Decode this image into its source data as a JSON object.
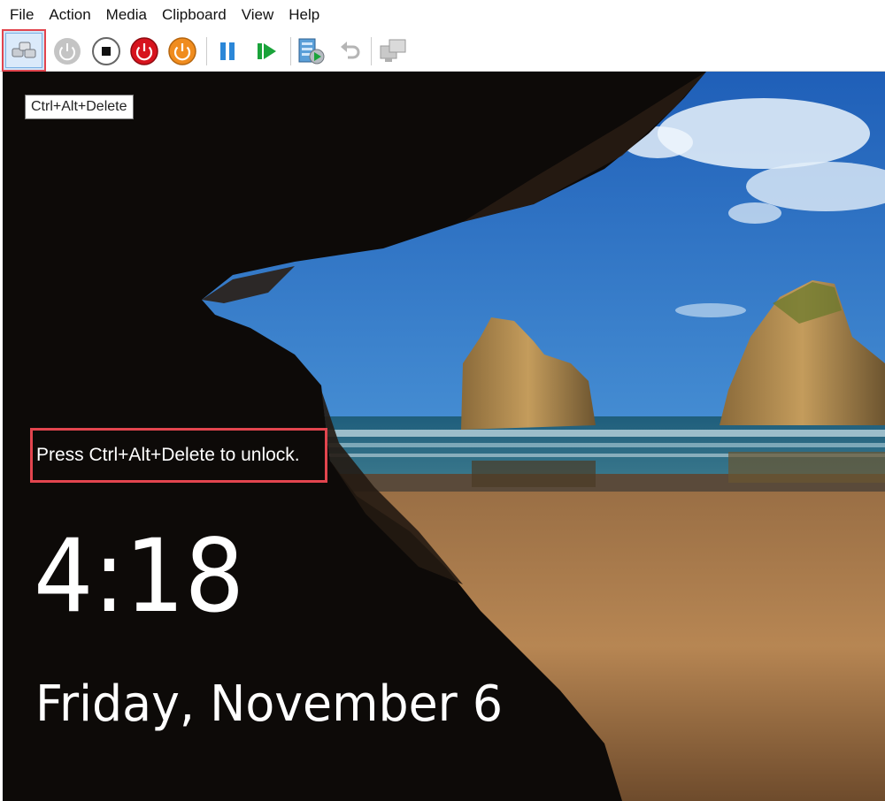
{
  "menu": [
    "File",
    "Action",
    "Media",
    "Clipboard",
    "View",
    "Help"
  ],
  "toolbar": {
    "buttons": [
      {
        "name": "ctrl-alt-delete",
        "icon": "ctrl-alt-delete-icon",
        "selected": true
      },
      {
        "name": "start",
        "icon": "start-icon"
      },
      {
        "name": "turn-off",
        "icon": "turn-off-icon"
      },
      {
        "name": "shut-down",
        "icon": "shut-down-icon"
      },
      {
        "name": "save",
        "icon": "save-icon"
      },
      {
        "name": "pause",
        "icon": "pause-icon"
      },
      {
        "name": "reset",
        "icon": "reset-icon"
      },
      {
        "name": "checkpoint",
        "icon": "checkpoint-icon"
      },
      {
        "name": "revert",
        "icon": "revert-icon"
      },
      {
        "name": "enhanced-session",
        "icon": "enhanced-session-icon"
      }
    ],
    "colors": {
      "selected_border": "#e2454e",
      "stop_red": "#d7141e",
      "save_orange": "#f08c1e",
      "pause_blue": "#2b87d8",
      "reset_green": "#1aa33a"
    }
  },
  "tooltip": "Ctrl+Alt+Delete",
  "lock_screen": {
    "hint": "Press Ctrl+Alt+Delete to unlock.",
    "time": "4:18",
    "date": "Friday, November 6"
  }
}
